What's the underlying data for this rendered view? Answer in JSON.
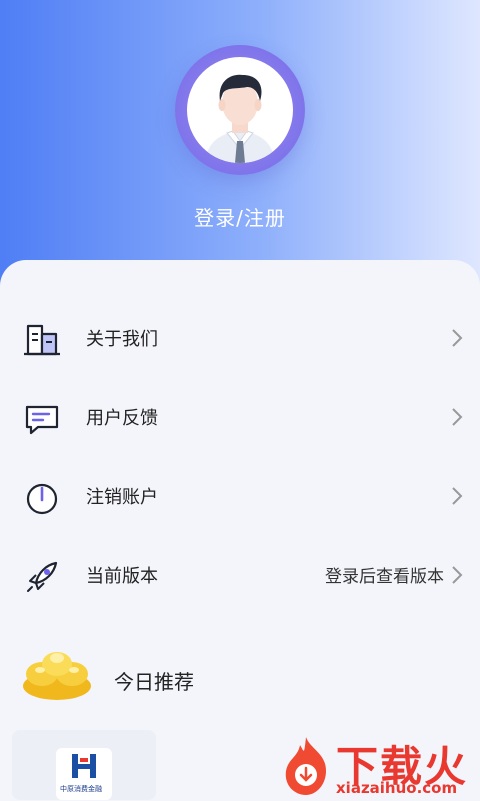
{
  "header": {
    "login_label": "登录/注册"
  },
  "menu": [
    {
      "label": "关于我们",
      "icon": "building-icon",
      "value": ""
    },
    {
      "label": "用户反馈",
      "icon": "feedback-message-icon",
      "value": ""
    },
    {
      "label": "注销账户",
      "icon": "power-icon",
      "value": ""
    },
    {
      "label": "当前版本",
      "icon": "rocket-icon",
      "value": "登录后查看版本"
    }
  ],
  "today": {
    "label": "今日推荐",
    "icon": "gold-ingot-icon"
  },
  "promo": {
    "logo_text": "中原消费金融"
  },
  "watermark": {
    "title": "下载火",
    "url": "xiazaihuo.com"
  },
  "colors": {
    "header_start": "#4f7ef5",
    "header_end": "#dfe7ff",
    "avatar_ring": "#7f74ea",
    "watermark": "#e8382f"
  }
}
